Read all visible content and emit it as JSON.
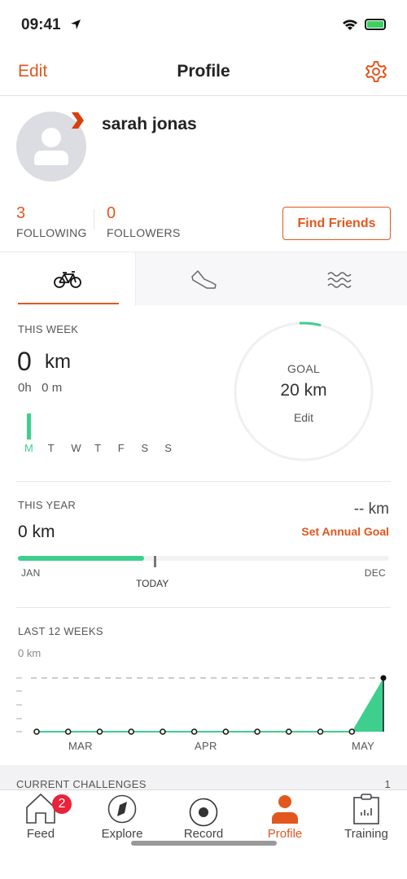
{
  "status": {
    "time": "09:41"
  },
  "header": {
    "edit": "Edit",
    "title": "Profile",
    "settings_icon": "gear-icon"
  },
  "profile": {
    "name": "sarah jonas",
    "following_count": "3",
    "following_label": "FOLLOWING",
    "followers_count": "0",
    "followers_label": "FOLLOWERS",
    "find_friends": "Find Friends"
  },
  "sport_tabs": [
    {
      "icon": "bike-icon",
      "active": true
    },
    {
      "icon": "shoe-icon"
    },
    {
      "icon": "swim-icon"
    }
  ],
  "week": {
    "label": "THIS WEEK",
    "distance": "0",
    "unit": "km",
    "time": "0h   0 m",
    "days": [
      "M",
      "T",
      "W",
      "T",
      "F",
      "S",
      "S"
    ],
    "active_day": 0,
    "goal_label": "GOAL",
    "goal_value": "20 km",
    "goal_edit": "Edit",
    "goal_progress": 0.05
  },
  "year": {
    "label": "THIS YEAR",
    "goal": "-- km",
    "distance": "0 km",
    "set_goal": "Set Annual Goal",
    "start": "JAN",
    "today": "TODAY",
    "end": "DEC",
    "elapsed_fraction": 0.34
  },
  "weeks": {
    "label": "LAST 12 WEEKS",
    "value": "0 km",
    "months": [
      "MAR",
      "APR",
      "MAY"
    ]
  },
  "chart_data": {
    "type": "area",
    "title": "LAST 12 WEEKS",
    "ylabel": "0 km",
    "categories": [
      "MAR",
      "APR",
      "MAY"
    ],
    "values": [
      0,
      0,
      0,
      0,
      0,
      0,
      0,
      0,
      0,
      0,
      0,
      0
    ],
    "selected_index": 11,
    "colors": {
      "fill": "#3ecf8e"
    }
  },
  "challenges": {
    "label": "CURRENT CHALLENGES",
    "count": "1"
  },
  "nav": [
    {
      "label": "Feed",
      "icon": "home-icon",
      "badge": "2"
    },
    {
      "label": "Explore",
      "icon": "compass-icon"
    },
    {
      "label": "Record",
      "icon": "record-icon"
    },
    {
      "label": "Profile",
      "icon": "person-icon",
      "active": true
    },
    {
      "label": "Training",
      "icon": "clipboard-icon"
    }
  ],
  "colors": {
    "accent": "#e2571e",
    "green": "#3ecf8e",
    "badge": "#e8233a"
  }
}
